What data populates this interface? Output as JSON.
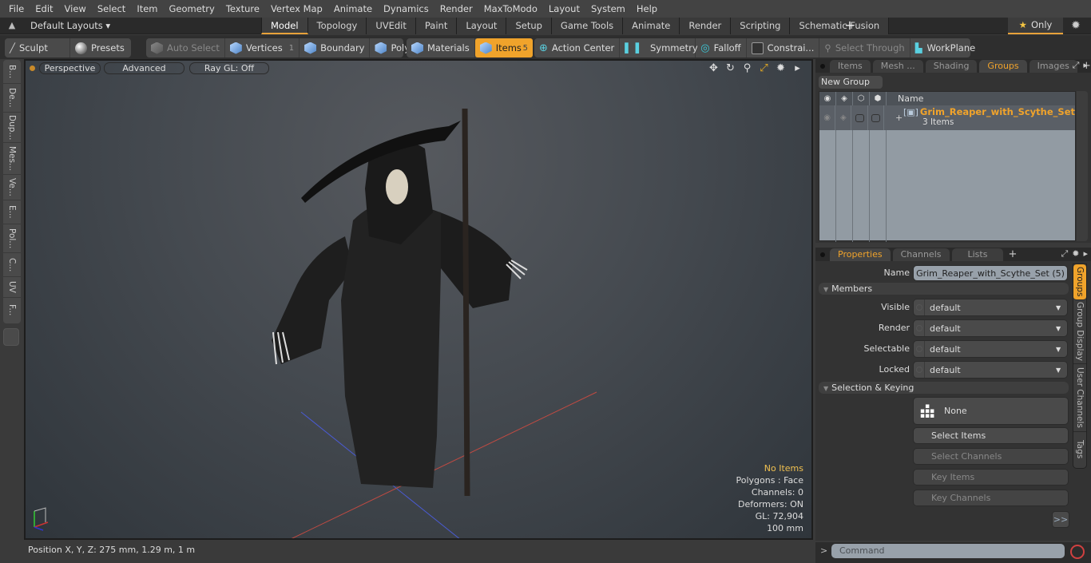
{
  "menu": [
    "File",
    "Edit",
    "View",
    "Select",
    "Item",
    "Geometry",
    "Texture",
    "Vertex Map",
    "Animate",
    "Dynamics",
    "Render",
    "MaxToModo",
    "Layout",
    "System",
    "Help"
  ],
  "layout_bar": {
    "layouts_label": "Default Layouts ▾",
    "tabs": [
      "Model",
      "Topology",
      "UVEdit",
      "Paint",
      "Layout",
      "Setup",
      "Game Tools",
      "Animate",
      "Render",
      "Scripting",
      "Schematic Fusion"
    ],
    "active_tab": "Model",
    "add_tab": "+",
    "only_label": "Only"
  },
  "toolbar": {
    "sculpt": "Sculpt",
    "presets": "Presets",
    "auto_select": "Auto Select",
    "vertices": "Vertices",
    "vertices_count": "1",
    "boundary": "Boundary",
    "polygons": "Polygons",
    "materials": "Materials",
    "items": "Items",
    "items_count": "5",
    "action_center": "Action Center",
    "symmetry": "Symmetry",
    "falloff": "Falloff",
    "constraints": "Constrai...",
    "select_through": "Select Through",
    "workplane": "WorkPlane"
  },
  "left_tabs": [
    "B...",
    "De...",
    "Dup...",
    "Mes...",
    "Ve...",
    "E...",
    "Pol...",
    "C...",
    "UV",
    "F..."
  ],
  "viewport": {
    "perspective": "Perspective",
    "advanced": "Advanced",
    "raygl": "Ray GL: Off",
    "info": {
      "selection": "No Items",
      "polygons": "Polygons : Face",
      "channels": "Channels: 0",
      "deformers": "Deformers: ON",
      "gl": "GL: 72,904",
      "scale": "100 mm"
    }
  },
  "status": {
    "position": "Position X, Y, Z:   275 mm, 1.29 m, 1 m"
  },
  "groups_panel": {
    "tabs": [
      "Items",
      "Mesh ...",
      "Shading",
      "Groups",
      "Images"
    ],
    "active_tab": "Groups",
    "new_group": "New Group",
    "col_name": "Name",
    "group": {
      "name": "Grim_Reaper_with_Scythe_Set",
      "count": "3 Items"
    }
  },
  "properties_panel": {
    "tabs": [
      "Properties",
      "Channels",
      "Lists"
    ],
    "active_tab": "Properties",
    "name_label": "Name",
    "name_value": "Grim_Reaper_with_Scythe_Set (5)",
    "members_section": "Members",
    "fields": [
      {
        "label": "Visible",
        "value": "default"
      },
      {
        "label": "Render",
        "value": "default"
      },
      {
        "label": "Selectable",
        "value": "default"
      },
      {
        "label": "Locked",
        "value": "default"
      }
    ],
    "selkey_section": "Selection & Keying",
    "none_label": "None",
    "select_items": "Select Items",
    "select_channels": "Select Channels",
    "key_items": "Key Items",
    "key_channels": "Key Channels",
    "more": ">>",
    "side_tabs": [
      "Groups",
      "Group Display",
      "User Channels",
      "Tags"
    ]
  },
  "command": {
    "prompt": ">",
    "placeholder": "Command"
  }
}
